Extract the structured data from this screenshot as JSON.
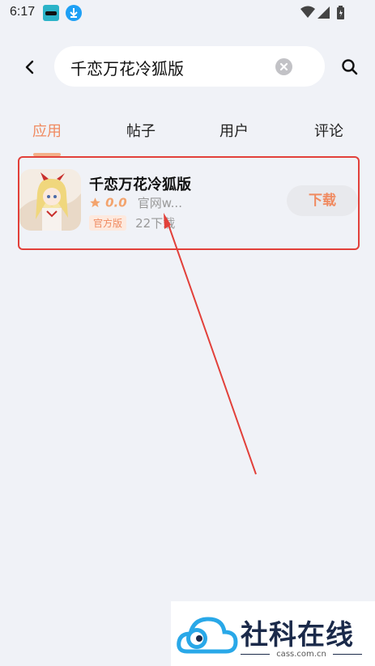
{
  "status_bar": {
    "time": "6:17"
  },
  "search": {
    "query": "千恋万花冷狐版"
  },
  "tabs": [
    {
      "label": "应用",
      "active": true
    },
    {
      "label": "帖子",
      "active": false
    },
    {
      "label": "用户",
      "active": false
    },
    {
      "label": "评论",
      "active": false
    }
  ],
  "result": {
    "name": "千恋万花冷狐版",
    "rating": "0.0",
    "publisher": "官网w...",
    "badge": "官方版",
    "downloads": "22下载",
    "download_label": "下载"
  },
  "watermark": {
    "title": "社科在线",
    "site": "cass.com.cn"
  },
  "colors": {
    "accent": "#f08a60",
    "highlight_box": "#e2403a",
    "background": "#f0f2f7"
  }
}
